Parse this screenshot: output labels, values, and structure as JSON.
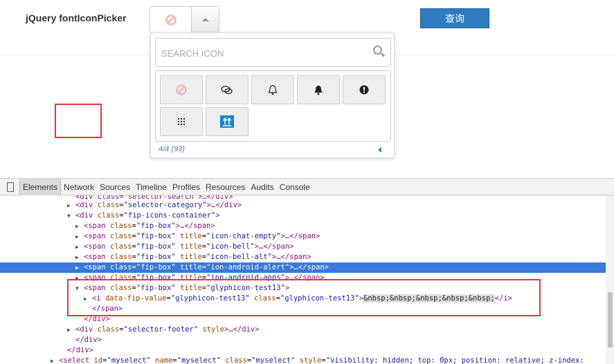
{
  "header": {
    "label": "jQuery fontIconPicker",
    "query_button": "查询"
  },
  "dropdown": {
    "search_placeholder": "SEARCH ICON",
    "pagination": "4/4 (93)",
    "icons": [
      "ban-icon",
      "chat-icon",
      "bell-outline-icon",
      "bell-icon",
      "alert-icon",
      "grid-icon",
      "glyphicon-test13-icon"
    ]
  },
  "devtools": {
    "tabs": [
      "Elements",
      "Network",
      "Sources",
      "Timeline",
      "Profiles",
      "Resources",
      "Audits",
      "Console"
    ],
    "lines": [
      {
        "text": "<div class=\"selector-search\">…</div>"
      },
      {
        "tag": "div",
        "attrs": [
          [
            "class",
            "selector-category"
          ]
        ],
        "tail": ">…</div>"
      },
      {
        "tag": "div",
        "attrs": [
          [
            "class",
            "fip-icons-container"
          ]
        ],
        "tail": ">"
      },
      {
        "tag": "span",
        "attrs": [
          [
            "class",
            "fip-box"
          ]
        ],
        "tail": ">…</span>"
      },
      {
        "tag": "span",
        "attrs": [
          [
            "class",
            "fip-box"
          ],
          [
            "title",
            "icon-chat-empty"
          ]
        ],
        "tail": ">…</span>"
      },
      {
        "tag": "span",
        "attrs": [
          [
            "class",
            "fip-box"
          ],
          [
            "title",
            "icon-bell"
          ]
        ],
        "tail": ">…</span>"
      },
      {
        "tag": "span",
        "attrs": [
          [
            "class",
            "fip-box"
          ],
          [
            "title",
            "icon-bell-alt"
          ]
        ],
        "tail": ">…</span>"
      },
      {
        "tag": "span",
        "attrs": [
          [
            "class",
            "fip-box"
          ],
          [
            "title",
            "ion-android-alert"
          ]
        ],
        "tail": ">…</span>"
      },
      {
        "tag": "span",
        "attrs": [
          [
            "class",
            "fip-box"
          ],
          [
            "title",
            "ion-android-apps"
          ]
        ],
        "tail": ">…</span>"
      },
      {
        "tag": "span",
        "attrs": [
          [
            "class",
            "fip-box"
          ],
          [
            "title",
            "glyphicon-test13"
          ]
        ],
        "tail": ">"
      },
      {
        "tag": "i",
        "attrs": [
          [
            "data-fip-value",
            "glyphicon-test13"
          ],
          [
            "class",
            "glyphicon-test13"
          ]
        ],
        "tail": ">",
        "nbsp": "&nbsp;&nbsp;&nbsp;&nbsp;&nbsp;",
        "close": "</i>"
      },
      {
        "text": "</span>"
      },
      {
        "text": "</div>"
      },
      {
        "tag": "div",
        "attrs": [
          [
            "class",
            "selector-footer"
          ],
          [
            "style",
            ""
          ]
        ],
        "tail": ">…</div>"
      },
      {
        "text": "</div>"
      },
      {
        "text": "</div>"
      },
      {
        "tag": "select",
        "attrs": [
          [
            "id",
            "myselect"
          ],
          [
            "name",
            "myselect"
          ],
          [
            "class",
            "myselect"
          ],
          [
            "style",
            "visibility: hidden; top: 0px; position: relative; z-index: "
          ]
        ],
        "tail": ""
      }
    ]
  }
}
